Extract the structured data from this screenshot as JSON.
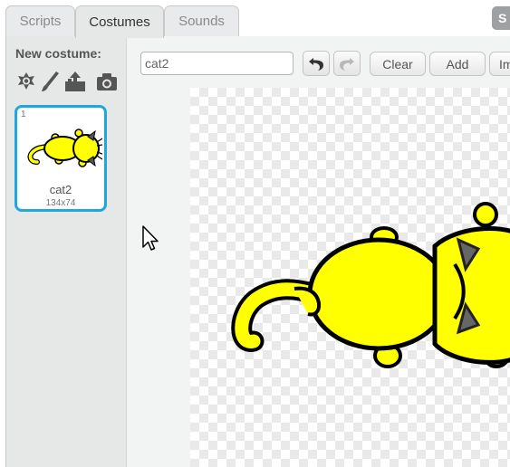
{
  "tabs": [
    {
      "label": "Scripts",
      "active": false
    },
    {
      "label": "Costumes",
      "active": true
    },
    {
      "label": "Sounds",
      "active": false
    }
  ],
  "corner_button_label": "S",
  "left_panel": {
    "new_costume_label": "New costume:",
    "tools": [
      "paint-from-library-icon",
      "paintbrush-icon",
      "upload-icon",
      "camera-icon"
    ],
    "costume": {
      "number": "1",
      "name": "cat2",
      "size": "134x74"
    }
  },
  "editor": {
    "costume_name_value": "cat2",
    "costume_name_placeholder": "",
    "buttons": {
      "clear": "Clear",
      "add": "Add",
      "import": "Im"
    }
  },
  "colors": {
    "selection_border": "#1fa8e0",
    "sprite_fill": "#ffff00",
    "sprite_outline": "#000000"
  }
}
